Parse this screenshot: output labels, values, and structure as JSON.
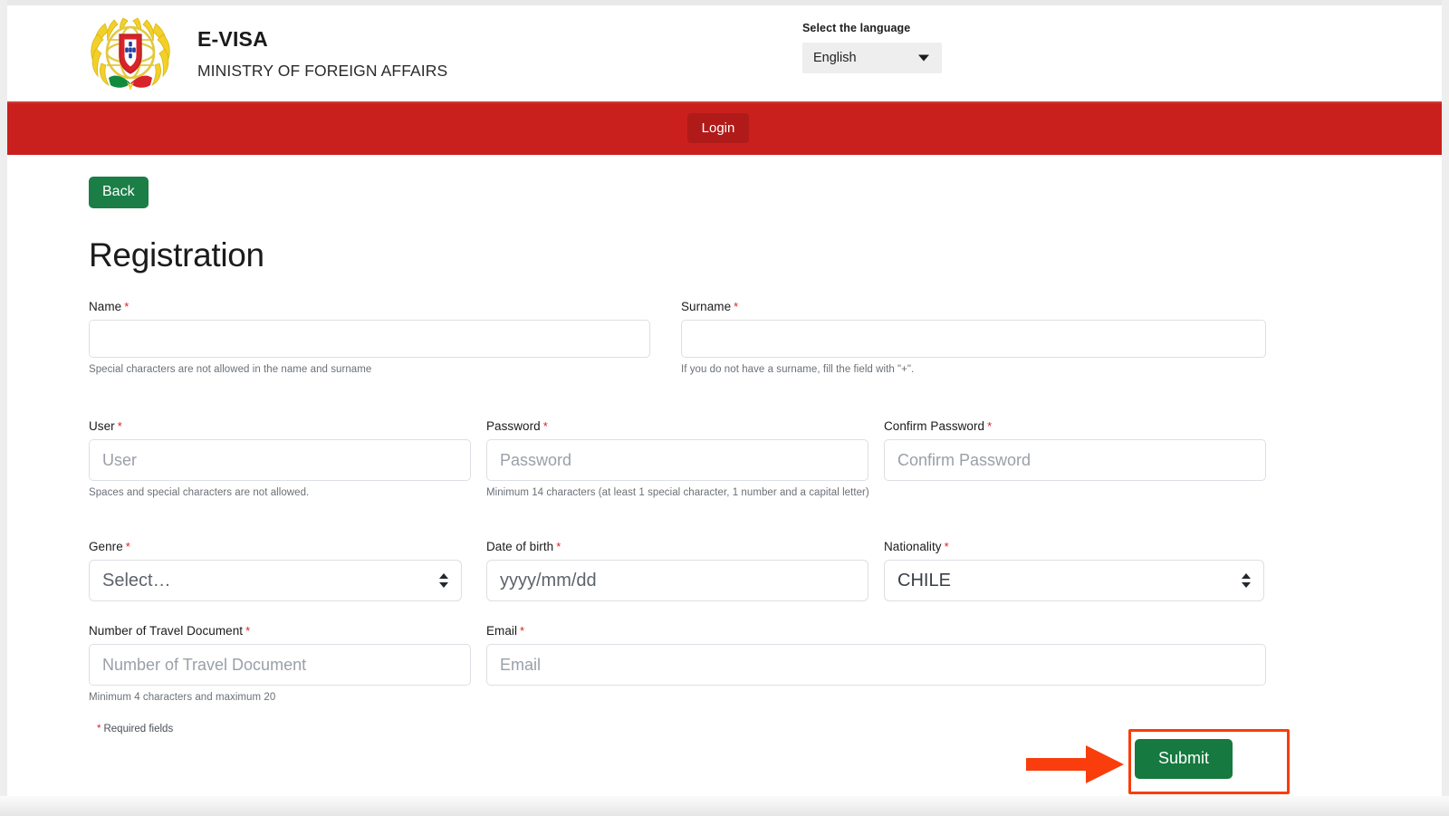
{
  "header": {
    "brand_title": "E-VISA",
    "brand_subtitle": "MINISTRY OF FOREIGN AFFAIRS",
    "logo_name": "portugal-coat-of-arms",
    "language": {
      "label": "Select the language",
      "selected": "English"
    }
  },
  "navbar": {
    "login_label": "Login",
    "background_color": "#c9201e",
    "login_background_color": "#b01b19"
  },
  "content": {
    "back_label": "Back",
    "page_title": "Registration",
    "required_note": "Required fields",
    "required_marker": "*",
    "submit_label": "Submit",
    "back_color": "#1b7e46",
    "submit_color": "#16793f"
  },
  "form": {
    "fields": [
      {
        "id": "name",
        "label": "Name",
        "required": true,
        "value": "",
        "placeholder": "",
        "help": "Special characters are not allowed in the name and surname"
      },
      {
        "id": "surname",
        "label": "Surname",
        "required": true,
        "value": "",
        "placeholder": "",
        "help": "If you do not have a surname, fill the field with \"+\"."
      },
      {
        "id": "user",
        "label": "User",
        "required": true,
        "value": "",
        "placeholder": "User",
        "help": "Spaces and special characters are not allowed."
      },
      {
        "id": "password",
        "label": "Password",
        "required": true,
        "value": "",
        "placeholder": "Password",
        "help": "Minimum 14 characters (at least 1 special character, 1 number and a capital letter)"
      },
      {
        "id": "confirm_password",
        "label": "Confirm Password",
        "required": true,
        "value": "",
        "placeholder": "Confirm Password",
        "help": ""
      },
      {
        "id": "genre",
        "label": "Genre",
        "required": true,
        "value": "Select…",
        "placeholder": "",
        "help": ""
      },
      {
        "id": "date_of_birth",
        "label": "Date of birth",
        "required": true,
        "value": "",
        "placeholder": "yyyy/mm/dd",
        "help": ""
      },
      {
        "id": "nationality",
        "label": "Nationality",
        "required": true,
        "value": "CHILE",
        "placeholder": "",
        "help": ""
      },
      {
        "id": "travel_document",
        "label": "Number of Travel Document",
        "required": true,
        "value": "",
        "placeholder": "Number of Travel Document",
        "help": "Minimum 4 characters and maximum 20"
      },
      {
        "id": "email",
        "label": "Email",
        "required": true,
        "value": "",
        "placeholder": "Email",
        "help": ""
      }
    ]
  },
  "annotation": {
    "highlight_color": "#f93d0c",
    "target": "submit-button",
    "arrow_name": "pointer-arrow"
  }
}
